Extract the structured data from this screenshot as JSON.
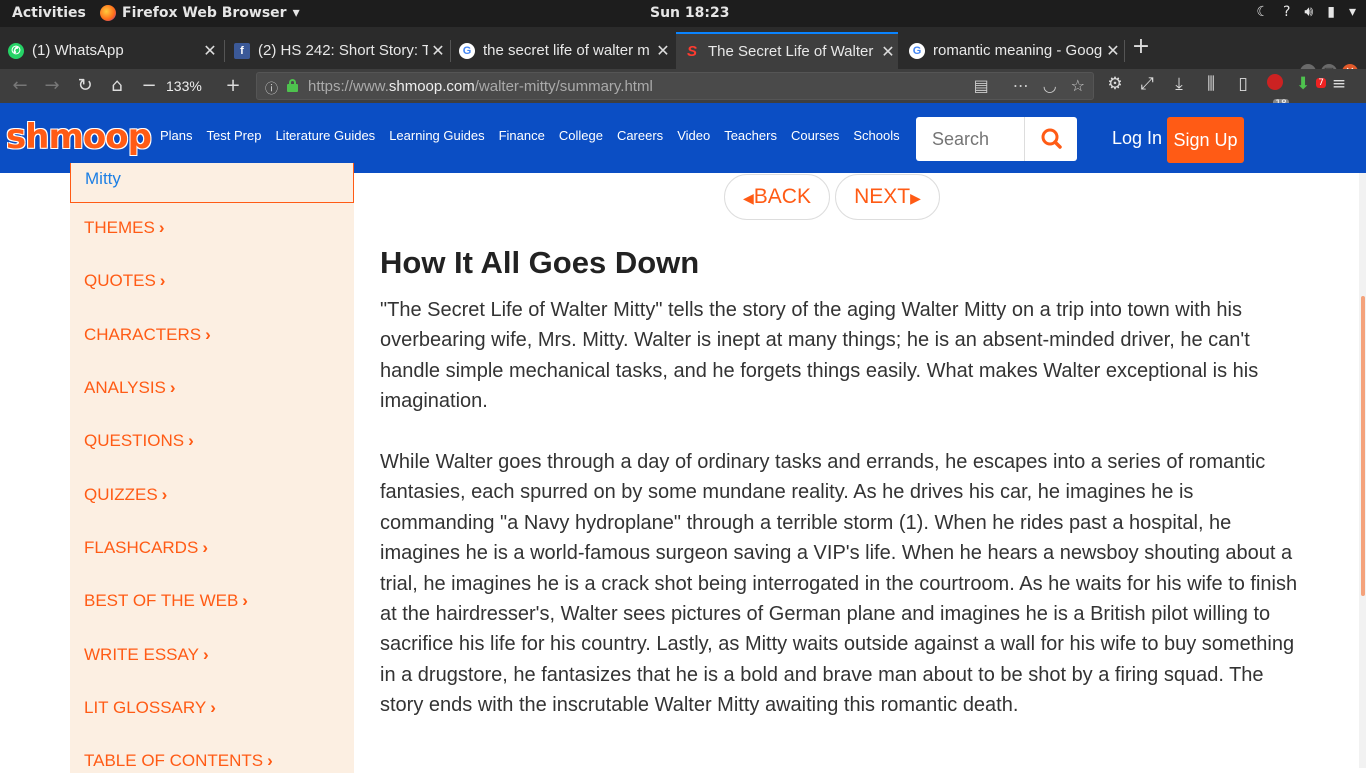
{
  "system_bar": {
    "activities": "Activities",
    "app_name": "Firefox Web Browser",
    "clock": "Sun 18:23"
  },
  "tabs": [
    {
      "title": "(1) WhatsApp",
      "icon": "whatsapp-icon"
    },
    {
      "title": "(2) HS 242: Short Story: T",
      "icon": "facebook-icon"
    },
    {
      "title": "the secret life of walter m",
      "icon": "google-icon"
    },
    {
      "title": "The Secret Life of Walter",
      "icon": "shmoop-icon"
    },
    {
      "title": "romantic meaning - Goog",
      "icon": "google-icon"
    }
  ],
  "browser": {
    "zoom": "133%",
    "url_prefix": "https://www.",
    "url_host": "shmoop.com",
    "url_path": "/walter-mitty/summary.html",
    "library_badge": "18",
    "download_badge": "7"
  },
  "site": {
    "logo": "shmoop",
    "nav": [
      "Plans",
      "Test Prep",
      "Literature Guides",
      "Learning Guides",
      "Finance",
      "College",
      "Careers",
      "Video",
      "Teachers",
      "Courses",
      "Schools"
    ],
    "search_placeholder": "Search",
    "login": "Log In",
    "signup": "Sign Up",
    "accent": "#ff5b15",
    "header_blue": "#0b4ec4"
  },
  "sidebar": {
    "previous_item": "Mitty",
    "items": [
      "THEMES",
      "QUOTES",
      "CHARACTERS",
      "ANALYSIS",
      "QUESTIONS",
      "QUIZZES",
      "FLASHCARDS",
      "BEST OF THE WEB",
      "WRITE ESSAY",
      "LIT GLOSSARY",
      "TABLE OF CONTENTS"
    ]
  },
  "pager": {
    "back": "BACK",
    "next": "NEXT"
  },
  "content": {
    "title": "How It All Goes Down",
    "paragraphs": [
      "\"The Secret Life of Walter Mitty\" tells the story of the aging Walter Mitty on a trip into town with his overbearing wife, Mrs. Mitty. Walter is inept at many things; he is an absent-minded driver, he can't handle simple mechanical tasks, and he forgets things easily. What makes Walter exceptional is his imagination.",
      "While Walter goes through a day of ordinary tasks and errands, he escapes into a series of romantic fantasies, each spurred on by some mundane reality. As he drives his car, he imagines he is commanding \"a Navy hydroplane\" through a terrible storm (1). When he rides past a hospital, he imagines he is a world-famous surgeon saving a VIP's life. When he hears a newsboy shouting about a trial, he imagines he is a crack shot being interrogated in the courtroom. As he waits for his wife to finish at the hairdresser's, Walter sees pictures of German plane and imagines he is a British pilot willing to sacrifice his life for his country. Lastly, as Mitty waits outside against a wall for his wife to buy something in a drugstore, he fantasizes that he is a bold and brave man about to be shot by a firing squad. The story ends with the inscrutable Walter Mitty awaiting this romantic death."
    ]
  }
}
